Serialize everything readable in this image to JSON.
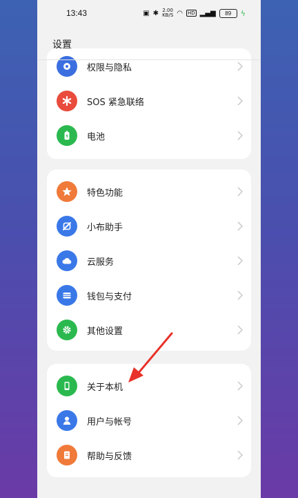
{
  "status_bar": {
    "time": "13:43",
    "net_speed": "2.00\nKB/S",
    "battery": "89"
  },
  "header": {
    "title": "设置"
  },
  "groups": [
    {
      "items": [
        {
          "label": "权限与隐私",
          "icon": "privacy-icon",
          "color": "#3b6fe0"
        },
        {
          "label": "SOS 紧急联络",
          "icon": "sos-icon",
          "color": "#e94b3c"
        },
        {
          "label": "电池",
          "icon": "battery-icon",
          "color": "#2bb94f"
        }
      ]
    },
    {
      "items": [
        {
          "label": "特色功能",
          "icon": "star-icon",
          "color": "#f07a3a"
        },
        {
          "label": "小布助手",
          "icon": "assistant-icon",
          "color": "#3a78e8"
        },
        {
          "label": "云服务",
          "icon": "cloud-icon",
          "color": "#3a78e8"
        },
        {
          "label": "钱包与支付",
          "icon": "wallet-icon",
          "color": "#3a78e8"
        },
        {
          "label": "其他设置",
          "icon": "gear-icon",
          "color": "#2bb94f"
        }
      ]
    },
    {
      "items": [
        {
          "label": "关于本机",
          "icon": "phone-icon",
          "color": "#2bb94f"
        },
        {
          "label": "用户与帐号",
          "icon": "user-icon",
          "color": "#3a78e8"
        },
        {
          "label": "帮助与反馈",
          "icon": "help-icon",
          "color": "#f07a3a"
        }
      ]
    }
  ],
  "annotation": {
    "arrow_color": "#e8322a"
  }
}
